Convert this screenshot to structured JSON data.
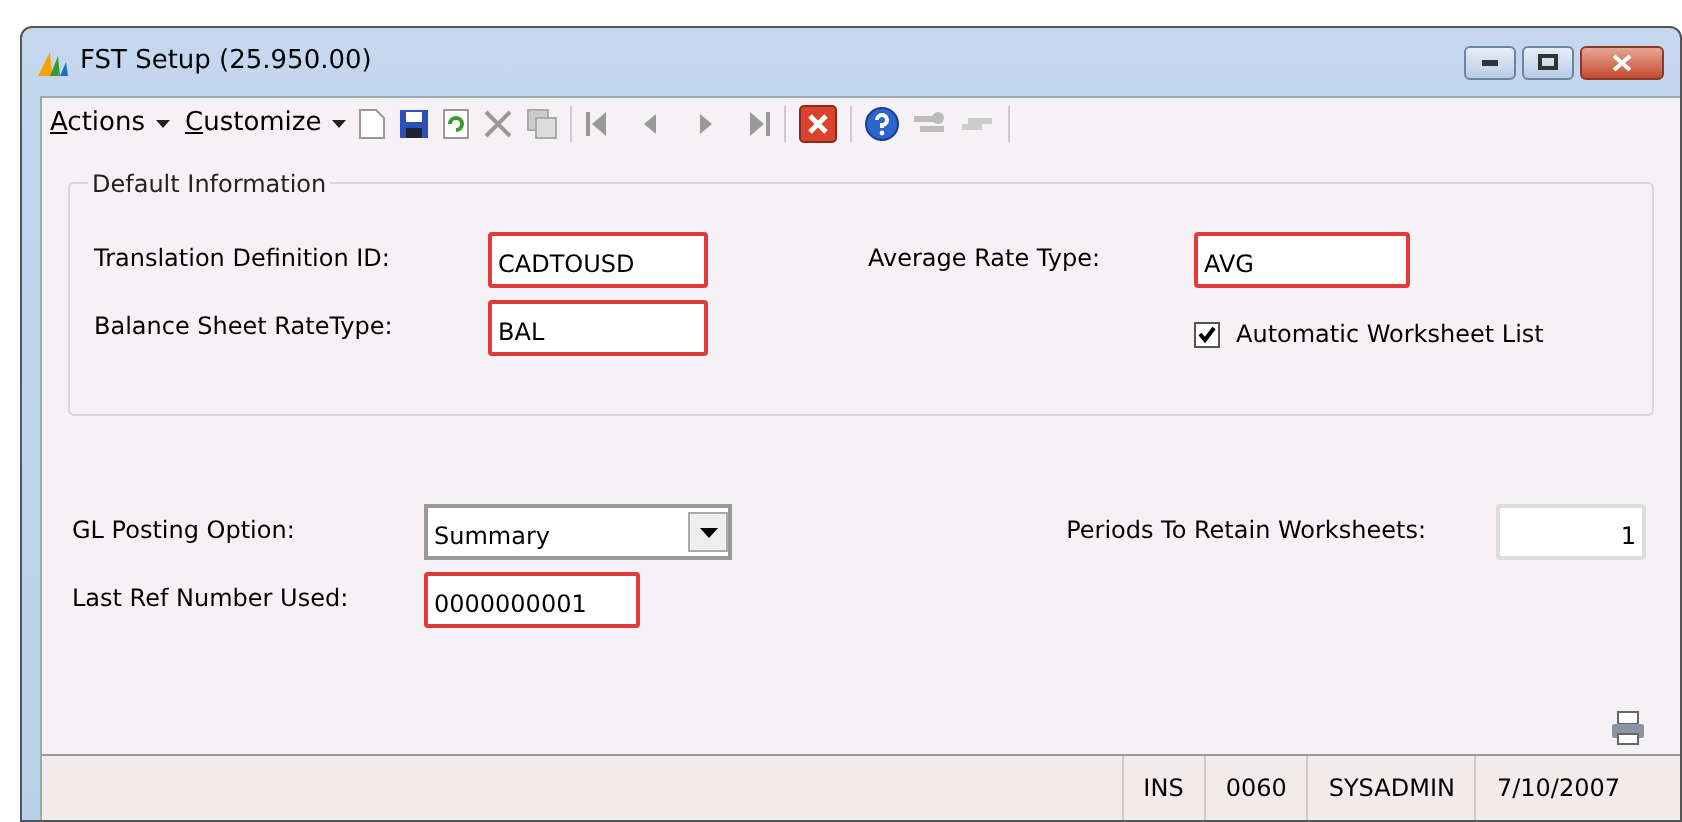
{
  "window": {
    "title": "FST Setup (25.950.00)"
  },
  "menus": [
    {
      "label": "Actions"
    },
    {
      "label": "Customize"
    }
  ],
  "default_information": {
    "title": "Default Information",
    "fields": [
      {
        "label": "Translation Definition ID:",
        "value": "CADTOUSD",
        "required": true
      },
      {
        "label": "Average Rate Type:",
        "value": "AVG",
        "required": true
      },
      {
        "label": "Balance Sheet RateType:",
        "value": "BAL",
        "required": true
      }
    ],
    "checkbox": {
      "label": "Automatic Worksheet List",
      "checked": true
    }
  },
  "gl_posting_option": {
    "label": "GL Posting Option:",
    "value": "Summary"
  },
  "periods_to_retain": {
    "label": "Periods To Retain Worksheets:",
    "value": "1",
    "required": false
  },
  "last_ref_number": {
    "label": "Last Ref Number Used:",
    "value": "0000000001",
    "required": true
  },
  "status_bar": [
    "INS",
    "0060",
    "SYSADMIN",
    "7/10/2007"
  ]
}
